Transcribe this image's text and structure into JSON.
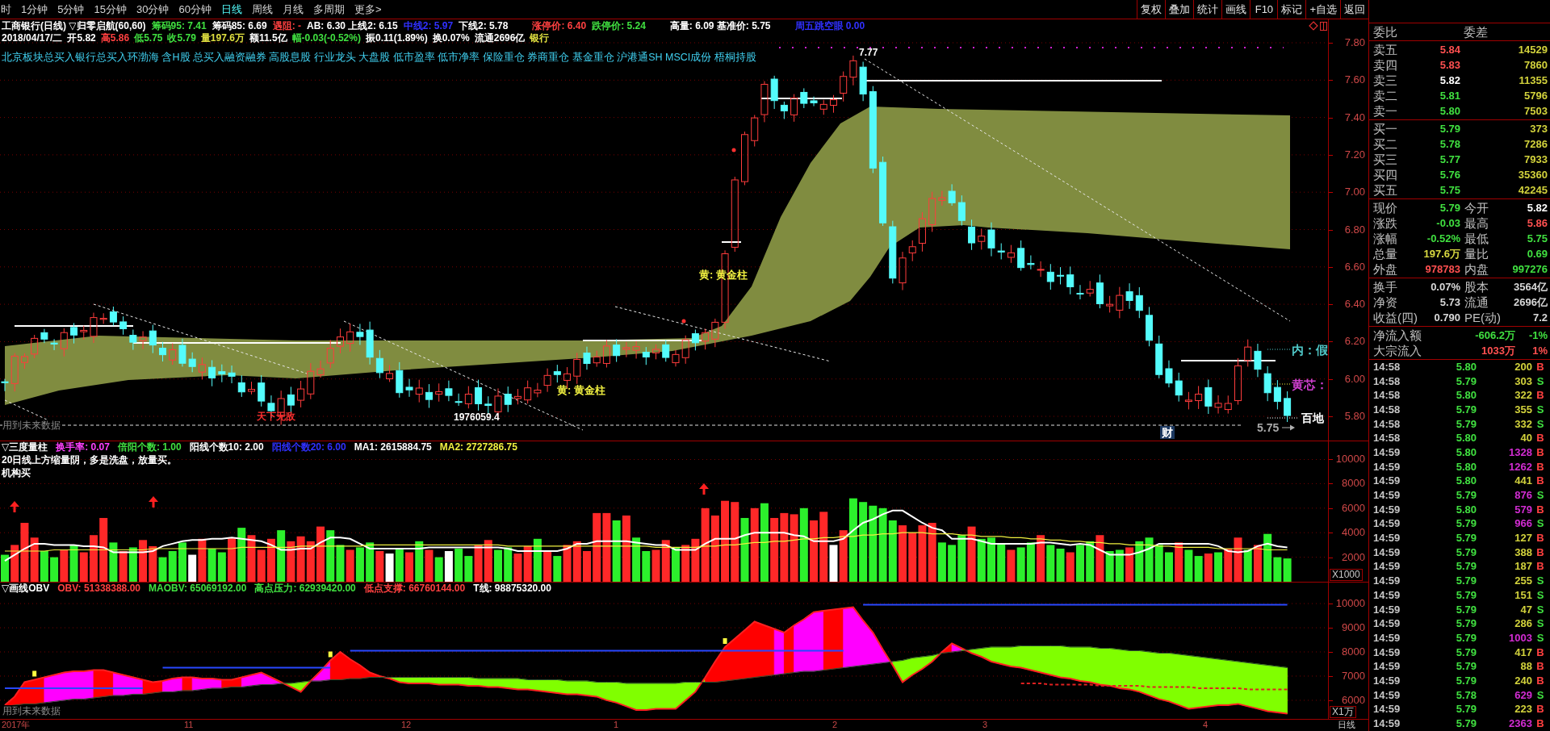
{
  "menu": [
    {
      "label": "时",
      "selected": false
    },
    {
      "label": "1分钟",
      "selected": false
    },
    {
      "label": "5分钟",
      "selected": false
    },
    {
      "label": "15分钟",
      "selected": false
    },
    {
      "label": "30分钟",
      "selected": false
    },
    {
      "label": "60分钟",
      "selected": false
    },
    {
      "label": "日线",
      "selected": true
    },
    {
      "label": "周线",
      "selected": false
    },
    {
      "label": "月线",
      "selected": false
    },
    {
      "label": "多周期",
      "selected": false
    },
    {
      "label": "更多>",
      "selected": false
    }
  ],
  "toolbar": [
    "复权",
    "叠加",
    "统计",
    "画线",
    "F10",
    "标记",
    "+自选",
    "返回"
  ],
  "price_chart": {
    "title_groups": [
      [
        {
          "text": "工商银行(日线) ▽归零启航(60,60)",
          "color": "#ffffff"
        },
        {
          "text": "筹码95: 7.41",
          "color": "#40e040"
        },
        {
          "text": "筹码85: 6.69",
          "color": "#ffffff"
        },
        {
          "text": "遇阻: -",
          "color": "#ff4040"
        },
        {
          "text": "AB: 6.30 上线2: 6.15",
          "color": "#ffffff"
        },
        {
          "text": "中线2: 5.97",
          "color": "#3030ff"
        },
        {
          "text": "下线2: 5.78",
          "color": "#ffffff"
        }
      ],
      [
        {
          "text": "涨停价: 6.40",
          "color": "#ff4040"
        },
        {
          "text": "跌停价: 5.24",
          "color": "#40e040"
        }
      ],
      [
        {
          "text": "高量: 6.09 基准价: 5.75",
          "color": "#ffffff"
        }
      ],
      [
        {
          "text": "周五跳空眼 0.00",
          "color": "#3030ff"
        }
      ]
    ],
    "quote_line": [
      {
        "text": "2018/04/17/二",
        "color": "#ffffff"
      },
      {
        "text": "开5.82",
        "color": "#ffffff"
      },
      {
        "text": "高5.86",
        "color": "#ff4040"
      },
      {
        "text": "低5.75",
        "color": "#40e040"
      },
      {
        "text": "收5.79",
        "color": "#40e040"
      },
      {
        "text": "量197.6万",
        "color": "#e0e040"
      },
      {
        "text": "额11.5亿",
        "color": "#ffffff"
      },
      {
        "text": "幅-0.03(-0.52%)",
        "color": "#40e040"
      },
      {
        "text": "振0.11(1.89%)",
        "color": "#ffffff"
      },
      {
        "text": "换0.07%",
        "color": "#ffffff"
      },
      {
        "text": "流通2696亿",
        "color": "#ffffff"
      },
      {
        "text": "银行",
        "color": "#e0e040"
      }
    ],
    "concepts": "北京板块总买入银行总买入环渤海 含H股 总买入融资融券 高股息股 行业龙头 大盘股 低市盈率 低市净率 保险重仓 券商重仓 基金重仓 沪港通SH MSCI成份 梧桐持股",
    "annotations": [
      {
        "text": "7.77",
        "color": "#ffffff",
        "boxed": false
      },
      {
        "text": "黄: 黄金柱",
        "color": "#f0f040",
        "boxed": false
      },
      {
        "text": "内：假",
        "color": "#50c8c8",
        "boxed": false
      },
      {
        "text": "黄: 黄金柱",
        "color": "#f0f040",
        "boxed": false
      },
      {
        "text": "黄芯：",
        "color": "#d040d0",
        "boxed": false
      },
      {
        "text": "天下无敌",
        "color": "#ff3030",
        "boxed": false
      },
      {
        "text": "1976059.4",
        "color": "#ffffff",
        "boxed": false
      },
      {
        "text": "百地",
        "color": "#ffffff",
        "boxed": false
      },
      {
        "text": "5.75",
        "color": "#a8a8a8",
        "boxed": false
      },
      {
        "text": "财",
        "color": "#ffffff",
        "boxed": true
      }
    ],
    "future_note": "用到未来数据",
    "axis": [
      "7.80",
      "7.60",
      "7.40",
      "7.20",
      "7.00",
      "6.80",
      "6.60",
      "6.40",
      "6.20",
      "6.00",
      "5.80"
    ]
  },
  "volume_chart": {
    "header": [
      {
        "text": "▽三度量柱",
        "color": "#ffffff"
      },
      {
        "text": "换手率: 0.07",
        "color": "#ff40ff"
      },
      {
        "text": "倍阳个数: 1.00",
        "color": "#40e040"
      },
      {
        "text": "阳线个数10: 2.00",
        "color": "#ffffff"
      },
      {
        "text": "阳线个数20: 6.00",
        "color": "#3030ff"
      },
      {
        "text": "MA1: 2615884.75",
        "color": "#ffffff"
      },
      {
        "text": "MA2: 2727286.75",
        "color": "#f0f040"
      }
    ],
    "notes": [
      "20日线上方缩量阴，多是洗盘，放量买。",
      "机构买"
    ],
    "chart_data": {
      "type": "bar",
      "grid": true,
      "ylim": [
        0,
        10000
      ],
      "yticks": [
        2000,
        4000,
        6000,
        8000,
        10000
      ],
      "series": [
        {
          "color": "#ff2828",
          "values": [
            null,
            3000,
            4800,
            3600,
            null,
            null,
            2600,
            null,
            2400,
            3800,
            5200,
            null,
            2500,
            null,
            3400,
            2900,
            null,
            null,
            null,
            null,
            3500,
            null,
            null,
            3600,
            null,
            3800,
            2600,
            3500,
            null,
            3300,
            3700,
            3300,
            4500,
            null,
            null,
            2600,
            null,
            null,
            2500,
            null,
            null,
            2400,
            null,
            2600,
            null,
            null,
            null,
            null,
            3000,
            3400,
            null,
            null,
            2300,
            2900,
            null,
            2500,
            null,
            3000,
            3300,
            2500,
            5600,
            5600,
            null,
            5400,
            null,
            null,
            2600,
            3400,
            null,
            3000,
            3500,
            6000,
            5400,
            6600,
            6500,
            null,
            6000,
            null,
            5200,
            5600,
            5500,
            null,
            5000,
            5700,
            null,
            4200,
            null,
            null,
            null,
            null,
            null,
            4600,
            4000,
            4600,
            4800,
            null,
            null,
            null,
            4500,
            null,
            null,
            null,
            2600,
            null,
            null,
            3800,
            null,
            null,
            2400,
            null,
            null,
            3800,
            null,
            null,
            2800,
            null,
            null,
            null,
            null,
            3200,
            null,
            null,
            2300,
            null,
            2700,
            3600,
            null,
            3000,
            null,
            null,
            null
          ]
        },
        {
          "color": "#2cf02c",
          "values": [
            2200,
            null,
            null,
            null,
            2500,
            2000,
            null,
            3000,
            null,
            null,
            null,
            3200,
            null,
            2800,
            null,
            null,
            2000,
            2500,
            3200,
            null,
            null,
            2700,
            2400,
            null,
            4400,
            null,
            null,
            null,
            4200,
            null,
            null,
            null,
            null,
            4200,
            3000,
            null,
            2800,
            3200,
            null,
            null,
            2700,
            null,
            3300,
            null,
            2000,
            null,
            2700,
            2100,
            null,
            null,
            2600,
            2800,
            null,
            null,
            3500,
            null,
            2100,
            null,
            null,
            null,
            null,
            null,
            5000,
            null,
            3600,
            2500,
            null,
            null,
            2800,
            null,
            null,
            null,
            null,
            null,
            null,
            5200,
            null,
            6400,
            null,
            null,
            null,
            6000,
            null,
            null,
            null,
            null,
            6800,
            6500,
            6200,
            6000,
            5000,
            null,
            null,
            null,
            null,
            3200,
            3000,
            3800,
            null,
            3500,
            3600,
            3100,
            null,
            2800,
            3200,
            null,
            3000,
            2700,
            null,
            3000,
            3300,
            null,
            2500,
            2600,
            null,
            3300,
            3600,
            3000,
            2400,
            null,
            2600,
            2100,
            null,
            2400,
            null,
            null,
            2600,
            null,
            3900,
            2000,
            1900
          ]
        },
        {
          "color": "#ffffff",
          "values": [
            null,
            null,
            null,
            null,
            null,
            null,
            null,
            null,
            null,
            null,
            null,
            null,
            null,
            null,
            null,
            null,
            null,
            null,
            null,
            2200,
            null,
            null,
            null,
            null,
            null,
            null,
            null,
            null,
            null,
            null,
            null,
            null,
            null,
            null,
            null,
            null,
            null,
            null,
            null,
            2300,
            null,
            null,
            null,
            null,
            null,
            2500,
            null,
            null,
            null,
            null,
            null,
            null,
            null,
            null,
            null,
            null,
            null,
            null,
            null,
            null,
            null,
            null,
            null,
            null,
            null,
            null,
            null,
            null,
            null,
            null,
            null,
            null,
            null,
            null,
            null,
            null,
            null,
            null,
            null,
            null,
            null,
            null,
            null,
            null,
            3000,
            null,
            null,
            null,
            null,
            null,
            null,
            null,
            null,
            null,
            null,
            null,
            null,
            null,
            null,
            null,
            null,
            null,
            null,
            null,
            null,
            null,
            null,
            null,
            null,
            null,
            null,
            null,
            null,
            null,
            null,
            null,
            null,
            null,
            null,
            null,
            null,
            null,
            null,
            null,
            null,
            null,
            null,
            null,
            null,
            null,
            null
          ]
        },
        {
          "type": "line",
          "color": "#ffffff",
          "values": [
            1700,
            2200,
            2700,
            3100,
            3100,
            3000,
            3000,
            3000,
            2900,
            2900,
            2800,
            2400,
            2400,
            2400,
            2400,
            2500,
            2900,
            3100,
            3300,
            3400,
            3400,
            3500,
            3500,
            3600,
            3500,
            3400,
            3300,
            3000,
            2600,
            2600,
            2700,
            2700,
            3200,
            3600,
            3600,
            3500,
            3100,
            2700,
            2700,
            2700,
            2700,
            2700,
            2700,
            2800,
            2800,
            2800,
            2800,
            2800,
            2800,
            2800,
            2800,
            2700,
            2500,
            2500,
            2500,
            2500,
            2500,
            2700,
            3100,
            3100,
            3300,
            3300,
            3300,
            3300,
            3200,
            3100,
            3000,
            3000,
            2600,
            2600,
            2600,
            3100,
            3500,
            3500,
            3500,
            3800,
            4000,
            4000,
            4000,
            4000,
            3800,
            3700,
            3300,
            3300,
            3300,
            3500,
            4200,
            4800,
            5100,
            5500,
            5800,
            5800,
            5300,
            4800,
            4400,
            4200,
            3500,
            3500,
            3500,
            3300,
            3100,
            3100,
            3100,
            3100,
            3100,
            3200,
            3200,
            3100,
            3000,
            3100,
            3000,
            2600,
            2200,
            2200,
            2200,
            2400,
            2700,
            3100,
            3100,
            3100,
            3100,
            3100,
            3100,
            2900,
            2500,
            2400,
            2500,
            2900,
            3100,
            2900,
            2800
          ]
        },
        {
          "type": "line",
          "color": "#f0f040",
          "values": [
            2500,
            2500,
            2500,
            2500,
            2500,
            2600,
            2600,
            2600,
            2600,
            2600,
            2600,
            2600,
            2600,
            2600,
            2600,
            2700,
            2700,
            2700,
            2700,
            2700,
            2700,
            2700,
            2700,
            2700,
            2800,
            2800,
            2800,
            2800,
            2800,
            2800,
            2900,
            2900,
            2900,
            2900,
            2900,
            2900,
            2900,
            3000,
            3000,
            3000,
            3000,
            3000,
            3000,
            3000,
            3000,
            3000,
            3000,
            3000,
            3000,
            3000,
            3000,
            2900,
            2900,
            2900,
            2900,
            2900,
            2900,
            2900,
            2900,
            2900,
            2900,
            2900,
            2900,
            2900,
            2900,
            2900,
            2800,
            2800,
            2800,
            2800,
            2800,
            2900,
            2900,
            3000,
            3000,
            3100,
            3200,
            3200,
            3300,
            3300,
            3400,
            3500,
            3500,
            3600,
            3600,
            3700,
            3700,
            3800,
            3800,
            3900,
            3900,
            4000,
            4000,
            4000,
            3900,
            3900,
            3900,
            3800,
            3800,
            3700,
            3700,
            3700,
            3600,
            3600,
            3500,
            3500,
            3400,
            3400,
            3300,
            3300,
            3200,
            3200,
            3100,
            3100,
            3000,
            3000,
            3000,
            2900,
            2900,
            2800,
            2800,
            2800,
            2800,
            2700,
            2700,
            2700,
            2700,
            2700,
            2600,
            2600,
            2600
          ]
        }
      ]
    },
    "unit": "X1000"
  },
  "obv_chart": {
    "header": [
      {
        "text": "▽画线OBV",
        "color": "#ffffff"
      },
      {
        "text": "OBV: 51338388.00",
        "color": "#ff4040"
      },
      {
        "text": "MAOBV: 65069192.00",
        "color": "#40e040"
      },
      {
        "text": "高点压力: 62939420.00",
        "color": "#40e040"
      },
      {
        "text": "低点支撑: 66760144.00",
        "color": "#ff4040"
      },
      {
        "text": "T线: 98875320.00",
        "color": "#ffffff"
      }
    ],
    "chart_data": {
      "type": "line",
      "grid": true,
      "ylim": [
        5230,
        10870
      ],
      "yticks": [
        6000,
        7000,
        8000,
        9000,
        10000
      ],
      "series": [
        {
          "color": "#ff2020",
          "values": [
            5800,
            6150,
            6750,
            6850,
            6950,
            7050,
            7150,
            7200,
            7200,
            7250,
            7250,
            7150,
            7050,
            6950,
            6850,
            6750,
            6800,
            6900,
            6950,
            6950,
            6900,
            6900,
            6850,
            6850,
            6950,
            7050,
            7150,
            6950,
            6750,
            6550,
            6350,
            6800,
            7200,
            7650,
            8000,
            7700,
            7450,
            7150,
            7000,
            6900,
            6750,
            6700,
            6700,
            6700,
            6650,
            6650,
            6650,
            6600,
            6600,
            6550,
            6550,
            6500,
            6450,
            6450,
            6400,
            6350,
            6300,
            6250,
            6250,
            6200,
            6150,
            6000,
            5900,
            5750,
            5600,
            5600,
            5650,
            5650,
            5650,
            6000,
            6350,
            6950,
            7600,
            8200,
            8550,
            8900,
            9250,
            9100,
            8950,
            8800,
            9100,
            9350,
            9650,
            9700,
            9750,
            9800,
            9850,
            9300,
            8800,
            8100,
            7450,
            6750,
            7050,
            7300,
            7600,
            8000,
            8350,
            8150,
            7950,
            7800,
            7600,
            7500,
            7400,
            7350,
            7250,
            7150,
            7050,
            6950,
            6900,
            6800,
            6750,
            6650,
            6600,
            6500,
            6450,
            6350,
            6200,
            6050,
            5950,
            5800,
            5650,
            5700,
            5750,
            5800,
            5800,
            5850,
            5750,
            5650,
            5550,
            5500,
            5450
          ]
        },
        {
          "color": "#305030",
          "values": [
            5750,
            5800,
            5850,
            5850,
            5900,
            5950,
            6000,
            6050,
            6050,
            6100,
            6150,
            6200,
            6200,
            6250,
            6250,
            6300,
            6350,
            6350,
            6400,
            6400,
            6450,
            6500,
            6500,
            6550,
            6550,
            6600,
            6650,
            6650,
            6700,
            6700,
            6750,
            6800,
            6800,
            6850,
            6850,
            6900,
            6900,
            6950,
            6950,
            6950,
            6950,
            6950,
            6950,
            6950,
            6950,
            6950,
            6950,
            6950,
            6900,
            6900,
            6900,
            6900,
            6900,
            6850,
            6850,
            6850,
            6850,
            6800,
            6800,
            6800,
            6750,
            6750,
            6750,
            6700,
            6700,
            6700,
            6700,
            6700,
            6700,
            6750,
            6750,
            6750,
            6750,
            6800,
            6850,
            6900,
            6950,
            7000,
            7050,
            7100,
            7150,
            7200,
            7200,
            7250,
            7300,
            7350,
            7400,
            7450,
            7500,
            7550,
            7600,
            7650,
            7750,
            7800,
            7850,
            7950,
            8000,
            8050,
            8100,
            8150,
            8200,
            8200,
            8200,
            8250,
            8250,
            8250,
            8250,
            8250,
            8200,
            8200,
            8200,
            8150,
            8150,
            8100,
            8050,
            8050,
            8000,
            7950,
            7950,
            7900,
            7850,
            7800,
            7750,
            7700,
            7650,
            7600,
            7550,
            7500,
            7450,
            7400,
            7350
          ]
        },
        {
          "color": "#2848ff",
          "values": [
            6500,
            6500,
            6500,
            6500,
            6500,
            6500,
            6500,
            6500,
            6500,
            6500,
            6500,
            6500,
            6500,
            6500,
            6500,
            null,
            7350,
            7350,
            7350,
            7350,
            7350,
            7350,
            7350,
            7350,
            7350,
            7350,
            7350,
            7350,
            7350,
            7350,
            7350,
            7350,
            7350,
            7350,
            null,
            8050,
            8050,
            8050,
            8050,
            8050,
            8050,
            8050,
            8050,
            8050,
            8050,
            8050,
            8050,
            8050,
            8050,
            8050,
            8050,
            8050,
            8050,
            8050,
            8050,
            8050,
            8050,
            8050,
            8050,
            8050,
            8050,
            8050,
            8050,
            8050,
            8050,
            8050,
            8050,
            8050,
            8050,
            8050,
            8050,
            8050,
            8050,
            8050,
            8050,
            8050,
            8050,
            8050,
            8050,
            8050,
            8050,
            8050,
            8050,
            8050,
            8050,
            8050,
            null,
            9950,
            9950,
            9950,
            9950,
            9950,
            9950,
            9950,
            9950,
            9950,
            9950,
            9950,
            9950,
            9950,
            9950,
            9950,
            9950,
            9950,
            9950,
            9950,
            9950,
            9950,
            9950,
            9950,
            9950,
            9950,
            9950,
            9950,
            9950,
            9950,
            9950,
            9950,
            9950,
            9950,
            9950,
            9950,
            9950,
            9950,
            9950,
            9950,
            9950,
            9950,
            9950,
            9950,
            9950
          ]
        },
        {
          "color": "#e02020",
          "line_style": "dashed",
          "values": [
            null,
            null,
            null,
            null,
            null,
            null,
            null,
            null,
            null,
            null,
            null,
            null,
            null,
            null,
            null,
            null,
            null,
            null,
            null,
            null,
            null,
            null,
            null,
            null,
            null,
            null,
            null,
            null,
            null,
            null,
            null,
            null,
            null,
            null,
            null,
            null,
            null,
            null,
            null,
            null,
            null,
            null,
            null,
            null,
            null,
            null,
            null,
            null,
            null,
            null,
            null,
            null,
            null,
            null,
            null,
            null,
            null,
            null,
            null,
            null,
            null,
            null,
            null,
            null,
            null,
            null,
            null,
            null,
            null,
            null,
            null,
            null,
            null,
            null,
            null,
            null,
            null,
            null,
            null,
            null,
            null,
            null,
            null,
            null,
            null,
            null,
            null,
            null,
            null,
            null,
            null,
            null,
            null,
            null,
            null,
            null,
            null,
            null,
            null,
            null,
            null,
            null,
            null,
            6700,
            6700,
            6700,
            6650,
            6650,
            6650,
            6650,
            6650,
            6600,
            6600,
            6600,
            6600,
            6600,
            6550,
            6550,
            6550,
            6550,
            6550,
            6500,
            6500,
            6500,
            6500,
            6500,
            6450,
            6450,
            6450,
            6450,
            6450
          ]
        }
      ]
    },
    "unit": "X1万",
    "future_note": "用到未来数据"
  },
  "date_axis": {
    "labels": [
      "2017年",
      "11",
      "12",
      "1",
      "2",
      "3",
      "4"
    ],
    "period": "日线"
  },
  "quote": {
    "ratio_labels": [
      "委比",
      "委差"
    ],
    "asks": [
      {
        "label": "卖五",
        "price": "5.84",
        "color": "#ff5050",
        "volume": "14529"
      },
      {
        "label": "卖四",
        "price": "5.83",
        "color": "#ff5050",
        "volume": "7860"
      },
      {
        "label": "卖三",
        "price": "5.82",
        "color": "#ffffff",
        "volume": "11355"
      },
      {
        "label": "卖二",
        "price": "5.81",
        "color": "#40e040",
        "volume": "5796"
      },
      {
        "label": "卖一",
        "price": "5.80",
        "color": "#40e040",
        "volume": "7503"
      }
    ],
    "bids": [
      {
        "label": "买一",
        "price": "5.79",
        "color": "#40e040",
        "volume": "373"
      },
      {
        "label": "买二",
        "price": "5.78",
        "color": "#40e040",
        "volume": "7286"
      },
      {
        "label": "买三",
        "price": "5.77",
        "color": "#40e040",
        "volume": "7933"
      },
      {
        "label": "买四",
        "price": "5.76",
        "color": "#40e040",
        "volume": "35360"
      },
      {
        "label": "买五",
        "price": "5.75",
        "color": "#40e040",
        "volume": "42245"
      }
    ],
    "stats": [
      {
        "label": "现价",
        "value": "5.79",
        "color": "#40e040"
      },
      {
        "label": "今开",
        "value": "5.82",
        "color": "#ffffff"
      },
      {
        "label": "涨跌",
        "value": "-0.03",
        "color": "#40e040"
      },
      {
        "label": "最高",
        "value": "5.86",
        "color": "#ff5050"
      },
      {
        "label": "涨幅",
        "value": "-0.52%",
        "color": "#40e040"
      },
      {
        "label": "最低",
        "value": "5.75",
        "color": "#40e040"
      },
      {
        "label": "总量",
        "value": "197.6万",
        "color": "#d8d840"
      },
      {
        "label": "量比",
        "value": "0.69",
        "color": "#40e040"
      },
      {
        "label": "外盘",
        "value": "978783",
        "color": "#ff5050"
      },
      {
        "label": "内盘",
        "value": "997276",
        "color": "#40e040"
      }
    ],
    "fundamentals": [
      {
        "label": "换手",
        "value": "0.07%"
      },
      {
        "label": "股本",
        "value": "3564亿"
      },
      {
        "label": "净资",
        "value": "5.73"
      },
      {
        "label": "流通",
        "value": "2696亿"
      },
      {
        "label": "收益(四)",
        "value": "0.790"
      },
      {
        "label": "PE(动)",
        "value": "7.2"
      }
    ],
    "flows": [
      {
        "label": "净流入额",
        "value": "-606.2万",
        "pct": "-1%",
        "color": "#40e040"
      },
      {
        "label": "大宗流入",
        "value": "1033万",
        "pct": "1%",
        "color": "#ff5050"
      }
    ]
  },
  "ticks": [
    {
      "time": "14:58",
      "price": "5.80",
      "volume": "200",
      "side": "B",
      "kind": "buy",
      "color": "#d2d23c"
    },
    {
      "time": "14:58",
      "price": "5.79",
      "volume": "303",
      "side": "S",
      "kind": "sell",
      "color": "#d2d23c"
    },
    {
      "time": "14:58",
      "price": "5.80",
      "volume": "322",
      "side": "B",
      "kind": "buy",
      "color": "#d2d23c"
    },
    {
      "time": "14:58",
      "price": "5.79",
      "volume": "355",
      "side": "S",
      "kind": "sell",
      "color": "#d2d23c"
    },
    {
      "time": "14:58",
      "price": "5.79",
      "volume": "332",
      "side": "S",
      "kind": "sell",
      "color": "#d2d23c"
    },
    {
      "time": "14:58",
      "price": "5.80",
      "volume": "40",
      "side": "B",
      "kind": "buy",
      "color": "#d2d23c"
    },
    {
      "time": "14:59",
      "price": "5.80",
      "volume": "1328",
      "side": "B",
      "kind": "buy",
      "color": "#d22cd2"
    },
    {
      "time": "14:59",
      "price": "5.80",
      "volume": "1262",
      "side": "B",
      "kind": "buy",
      "color": "#d22cd2"
    },
    {
      "time": "14:59",
      "price": "5.80",
      "volume": "441",
      "side": "B",
      "kind": "buy",
      "color": "#d2d23c"
    },
    {
      "time": "14:59",
      "price": "5.79",
      "volume": "876",
      "side": "S",
      "kind": "sell",
      "color": "#d22cd2"
    },
    {
      "time": "14:59",
      "price": "5.80",
      "volume": "579",
      "side": "B",
      "kind": "buy",
      "color": "#d22cd2"
    },
    {
      "time": "14:59",
      "price": "5.79",
      "volume": "966",
      "side": "S",
      "kind": "sell",
      "color": "#d22cd2"
    },
    {
      "time": "14:59",
      "price": "5.79",
      "volume": "127",
      "side": "B",
      "kind": "buy",
      "color": "#d2d23c"
    },
    {
      "time": "14:59",
      "price": "5.79",
      "volume": "388",
      "side": "B",
      "kind": "buy",
      "color": "#d2d23c"
    },
    {
      "time": "14:59",
      "price": "5.79",
      "volume": "187",
      "side": "B",
      "kind": "buy",
      "color": "#d2d23c"
    },
    {
      "time": "14:59",
      "price": "5.79",
      "volume": "255",
      "side": "S",
      "kind": "sell",
      "color": "#d2d23c"
    },
    {
      "time": "14:59",
      "price": "5.79",
      "volume": "151",
      "side": "S",
      "kind": "sell",
      "color": "#d2d23c"
    },
    {
      "time": "14:59",
      "price": "5.79",
      "volume": "47",
      "side": "S",
      "kind": "sell",
      "color": "#d2d23c"
    },
    {
      "time": "14:59",
      "price": "5.79",
      "volume": "286",
      "side": "S",
      "kind": "sell",
      "color": "#d2d23c"
    },
    {
      "time": "14:59",
      "price": "5.79",
      "volume": "1003",
      "side": "S",
      "kind": "sell",
      "color": "#d22cd2"
    },
    {
      "time": "14:59",
      "price": "5.79",
      "volume": "417",
      "side": "B",
      "kind": "buy",
      "color": "#d2d23c"
    },
    {
      "time": "14:59",
      "price": "5.79",
      "volume": "88",
      "side": "B",
      "kind": "buy",
      "color": "#d2d23c"
    },
    {
      "time": "14:59",
      "price": "5.79",
      "volume": "240",
      "side": "B",
      "kind": "buy",
      "color": "#d2d23c"
    },
    {
      "time": "14:59",
      "price": "5.78",
      "volume": "629",
      "side": "S",
      "kind": "sell",
      "color": "#d22cd2"
    },
    {
      "time": "14:59",
      "price": "5.79",
      "volume": "223",
      "side": "B",
      "kind": "buy",
      "color": "#d2d23c"
    },
    {
      "time": "14:59",
      "price": "5.79",
      "volume": "2363",
      "side": "B",
      "kind": "buy",
      "color": "#d22cd2"
    }
  ]
}
